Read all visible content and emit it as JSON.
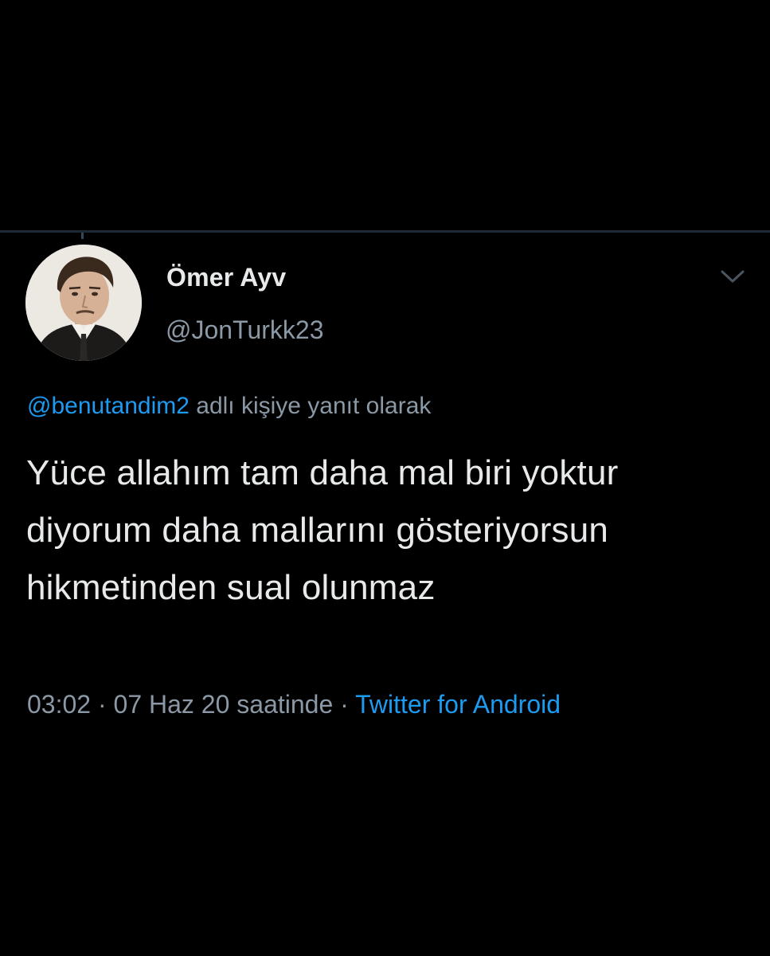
{
  "tweet": {
    "author": {
      "display_name": "Ömer Ayv",
      "handle": "@JonTurkk23",
      "avatar_icon": "profile-photo"
    },
    "reply_to": {
      "mention": "@benutandim2",
      "suffix": " adlı kişiye yanıt olarak"
    },
    "text": "Yüce allahım tam daha mal biri yoktur diyorum daha mallarını gösteriyorsun hikmetinden sual olunmaz",
    "time": "03:02",
    "separator": " · ",
    "date": "07 Haz 20 saatinde",
    "source": "Twitter for Android",
    "menu_icon": "chevron-down-icon"
  },
  "colors": {
    "background": "#000000",
    "text": "#e7e9ea",
    "muted": "#8b98a5",
    "accent": "#1d9bf0",
    "divider": "#1f2a36"
  }
}
